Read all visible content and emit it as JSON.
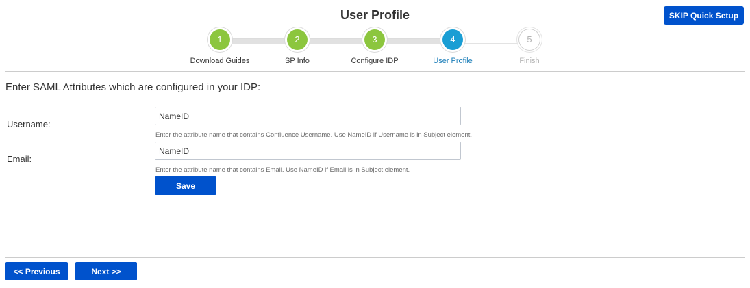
{
  "header": {
    "title": "User Profile",
    "skip_label": "SKIP Quick Setup"
  },
  "stepper": {
    "steps": [
      {
        "number": "1",
        "label": "Download Guides",
        "state": "complete"
      },
      {
        "number": "2",
        "label": "SP Info",
        "state": "complete"
      },
      {
        "number": "3",
        "label": "Configure IDP",
        "state": "complete"
      },
      {
        "number": "4",
        "label": "User Profile",
        "state": "active"
      },
      {
        "number": "5",
        "label": "Finish",
        "state": "pending"
      }
    ],
    "colors": {
      "complete": "#8cc63e",
      "active": "#1a9ed4",
      "pending": "#ffffff"
    }
  },
  "form": {
    "heading": "Enter SAML Attributes which are configured in your IDP:",
    "username": {
      "label": "Username:",
      "value": "NameID",
      "help": "Enter the attribute name that contains Confluence Username. Use NameID if Username is in Subject element."
    },
    "email": {
      "label": "Email:",
      "value": "NameID",
      "help": "Enter the attribute name that contains Email. Use NameID if Email is in Subject element."
    },
    "save_label": "Save"
  },
  "footer": {
    "previous_label": "<< Previous",
    "next_label": "Next >>"
  },
  "colors": {
    "primary": "#0052cc"
  }
}
